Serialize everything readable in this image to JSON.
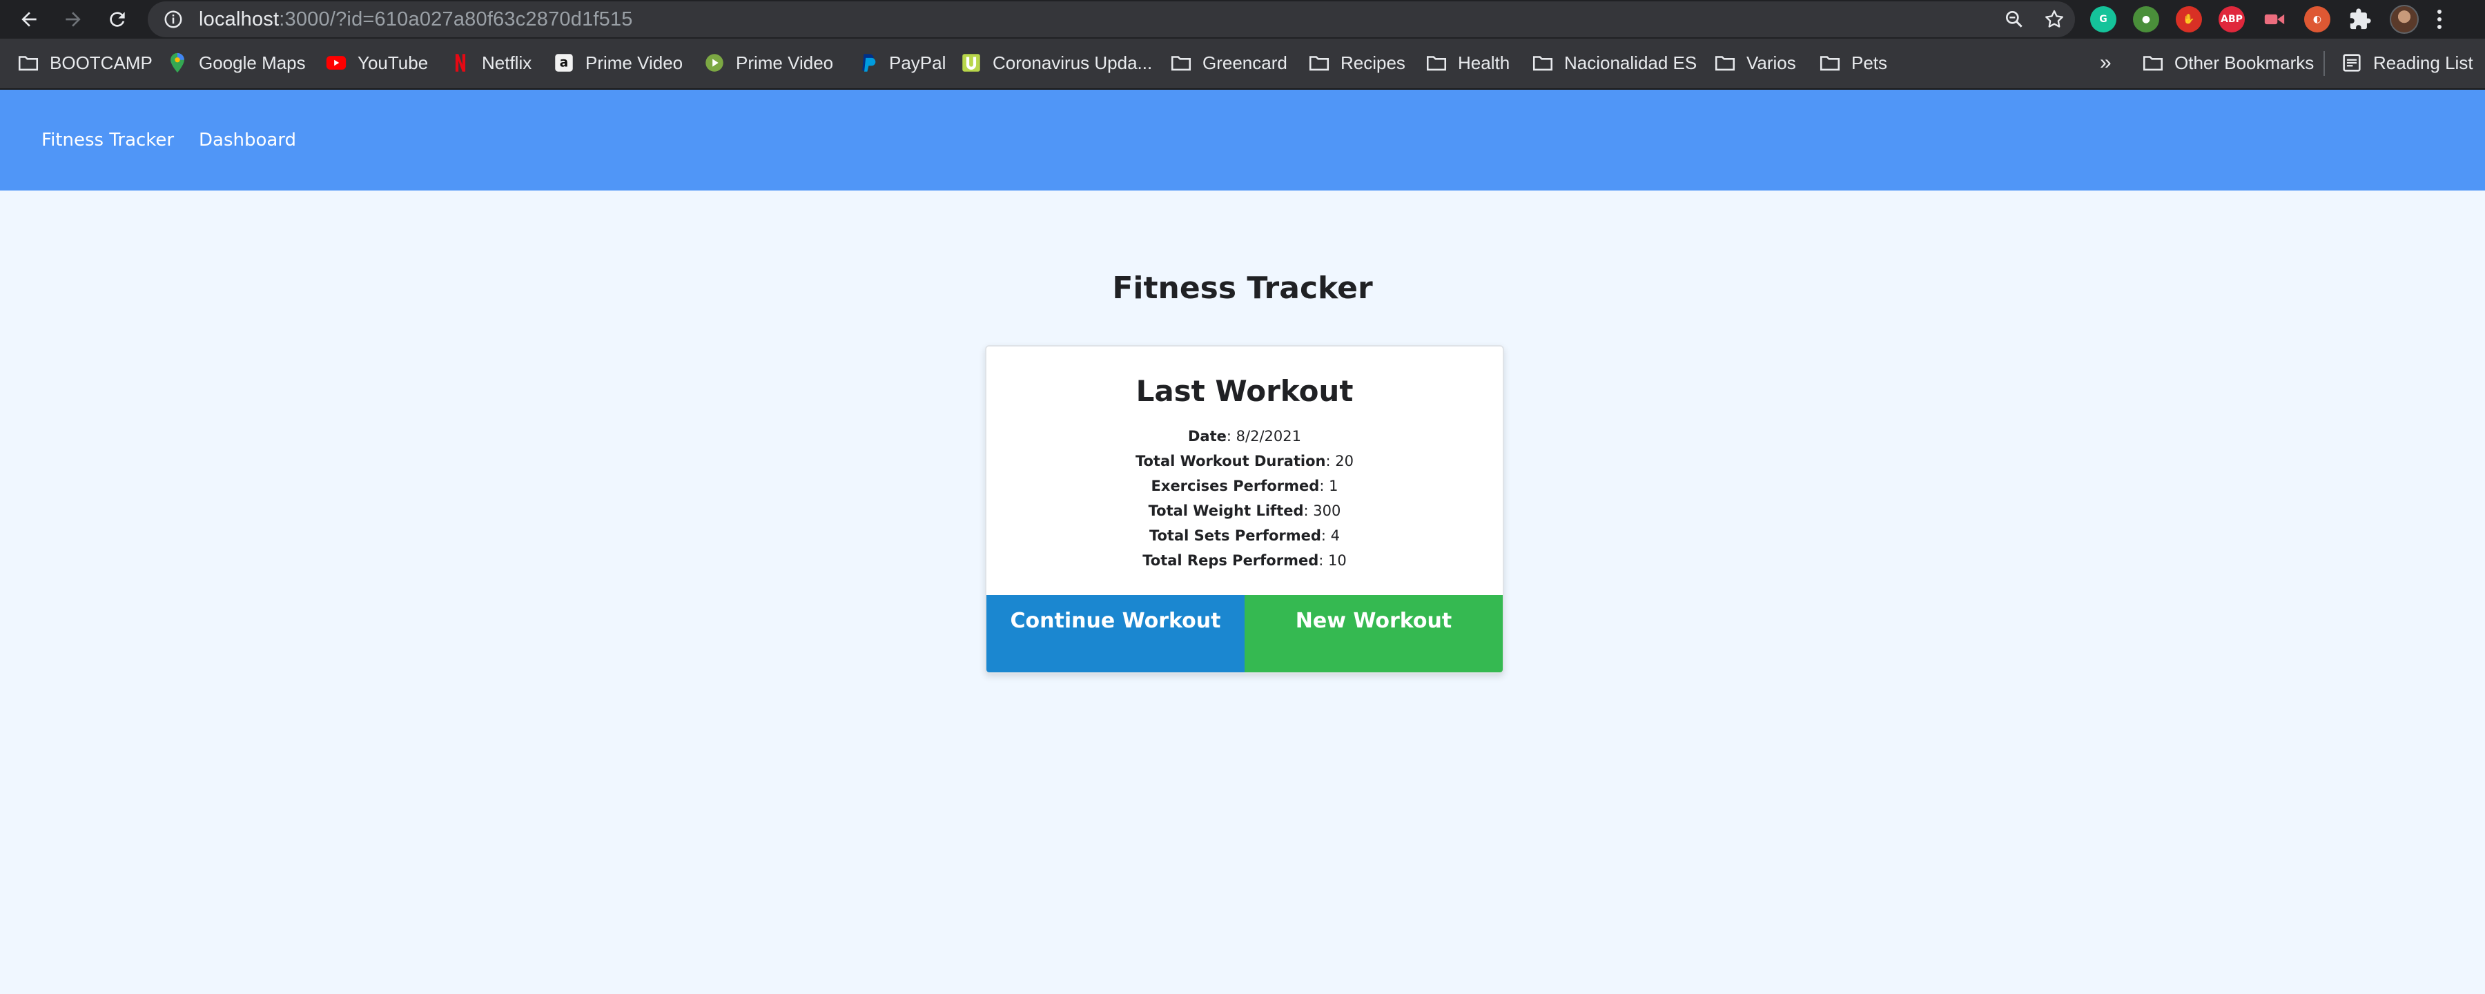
{
  "browser": {
    "url_host": "localhost",
    "url_rest": ":3000/?id=610a027a80f63c2870d1f515"
  },
  "bookmarks": [
    {
      "label": "BOOTCAMP",
      "icon": "folder-icon"
    },
    {
      "label": "Google Maps",
      "icon": "google-maps-icon"
    },
    {
      "label": "YouTube",
      "icon": "youtube-icon"
    },
    {
      "label": "Netflix",
      "icon": "netflix-icon"
    },
    {
      "label": "Prime Video",
      "icon": "amazon-icon"
    },
    {
      "label": "Prime Video",
      "icon": "prime-video-icon"
    },
    {
      "label": "PayPal",
      "icon": "paypal-icon"
    },
    {
      "label": "Coronavirus Upda...",
      "icon": "coronavirus-icon"
    },
    {
      "label": "Greencard",
      "icon": "folder-icon"
    },
    {
      "label": "Recipes",
      "icon": "folder-icon"
    },
    {
      "label": "Health",
      "icon": "folder-icon"
    },
    {
      "label": "Nacionalidad ES",
      "icon": "folder-icon"
    },
    {
      "label": "Varios",
      "icon": "folder-icon"
    },
    {
      "label": "Pets",
      "icon": "folder-icon"
    }
  ],
  "bookmarks_overflow": "»",
  "other_bookmarks": "Other Bookmarks",
  "reading_list": "Reading List",
  "extensions": [
    {
      "name": "grammarly-icon",
      "label": "",
      "color": "#15c39a"
    },
    {
      "name": "chrome-extension-icon",
      "label": "",
      "color": "#4a8f3a"
    },
    {
      "name": "stop-hand-icon",
      "label": "",
      "color": "#d93025"
    },
    {
      "name": "adblock-plus-icon",
      "label": "ABP",
      "color": "#e0283c"
    },
    {
      "name": "video-extension-icon",
      "label": "",
      "color": "#ec6d7e"
    },
    {
      "name": "duckduckgo-icon",
      "label": "",
      "color": "#de5833"
    }
  ],
  "app": {
    "nav": {
      "brand": "Fitness Tracker",
      "dashboard": "Dashboard"
    },
    "page_title": "Fitness Tracker",
    "card": {
      "title": "Last Workout",
      "stats": [
        {
          "label": "Date",
          "value": "8/2/2021"
        },
        {
          "label": "Total Workout Duration",
          "value": "20"
        },
        {
          "label": "Exercises Performed",
          "value": "1"
        },
        {
          "label": "Total Weight Lifted",
          "value": "300"
        },
        {
          "label": "Total Sets Performed",
          "value": "4"
        },
        {
          "label": "Total Reps Performed",
          "value": "10"
        }
      ],
      "continue_label": "Continue Workout",
      "new_label": "New Workout"
    },
    "colors": {
      "nav_bg": "#5096f7",
      "page_bg": "#f0f7ff",
      "continue_btn": "#1b87d0",
      "new_btn": "#35b951"
    }
  }
}
